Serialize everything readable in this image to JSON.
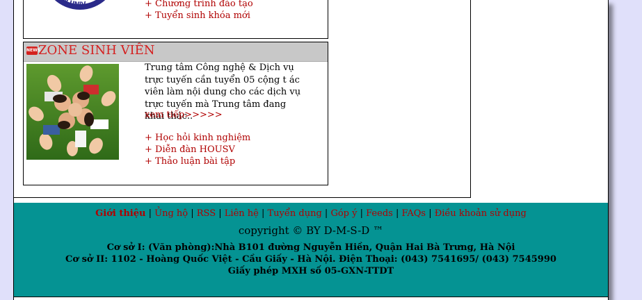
{
  "box1": {
    "links": [
      "+ Chương trình đào tạo",
      "+ Tuyển sinh khóa mới"
    ]
  },
  "zone": {
    "icon_text": "NEWS",
    "title": "ZONE SINH VIÊN",
    "description": "Trung tâm Công nghệ & Dịch vụ trực tuyến cần tuyển 05 cộng t ác viên làm nội dung cho các dịch vụ trực tuyến mà Trung tâm đang khai thác..",
    "more": "xem tiếp>>>>>",
    "links": [
      "+ Học hỏi kinh nghiệm",
      "+ Diễn đàn HOUSV",
      "+ Thảo luận bài tập"
    ]
  },
  "footer": {
    "nav": [
      "Giới thiệu",
      "Ủng hộ",
      "RSS",
      "Liên hệ",
      "Tuyển dụng",
      "Góp ý",
      "Feeds",
      "FAQs",
      "Điều khoản sử dụng"
    ],
    "copyright": "copyright © BY D-M-S-D ™",
    "address1": "Cơ sở I: (Văn phòng):Nhà B101 đường Nguyễn Hiền, Quận Hai Bà Trưng, Hà Nội",
    "address2": "Cơ sở II: 1102 - Hoàng Quốc Việt - Cầu Giấy - Hà Nội. Điện Thoại: (043) 7541695/ (043) 7545990",
    "license": "Giấy phép MXH số 05-GXN-TTDT"
  },
  "colors": {
    "link": "#b00000",
    "title": "#d42020",
    "footer_bg": "#059393",
    "page_bg": "#e0e0fa"
  }
}
